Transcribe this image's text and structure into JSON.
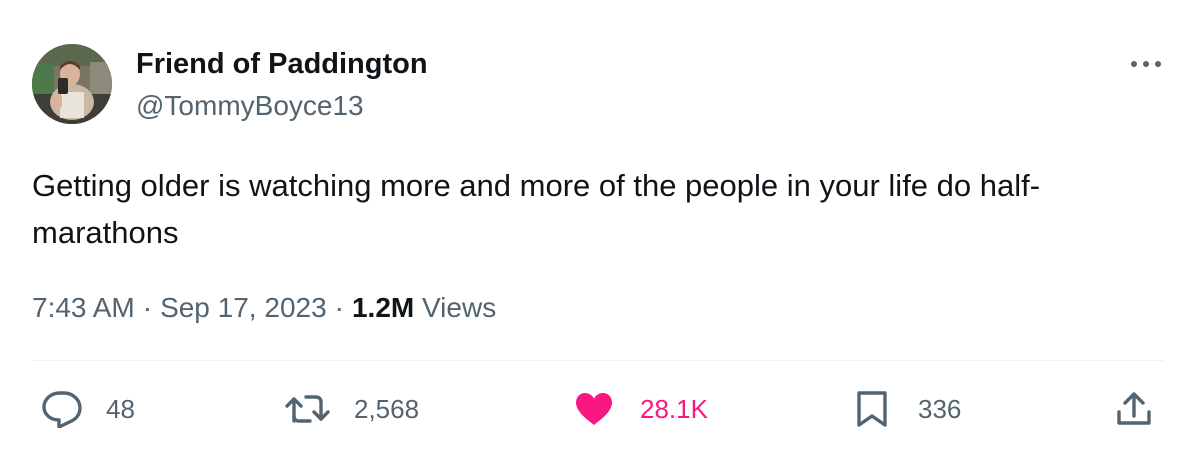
{
  "author": {
    "display_name": "Friend of Paddington",
    "handle": "@TommyBoyce13"
  },
  "tweet": {
    "text": "Getting older is watching more and more of the people in your life do half-marathons"
  },
  "meta": {
    "time": "7:43 AM",
    "separator": "·",
    "date": "Sep 17, 2023",
    "views_count": "1.2M",
    "views_label": "Views"
  },
  "actions": {
    "replies": "48",
    "retweets": "2,568",
    "likes": "28.1K",
    "bookmarks": "336"
  },
  "icons": {
    "reply": "reply-icon",
    "retweet": "retweet-icon",
    "like": "heart-icon",
    "bookmark": "bookmark-icon",
    "share": "share-icon",
    "more": "more-icon"
  },
  "colors": {
    "text_primary": "#0f1419",
    "text_secondary": "#536471",
    "like_active": "#f91880",
    "divider": "#eff3f4"
  }
}
